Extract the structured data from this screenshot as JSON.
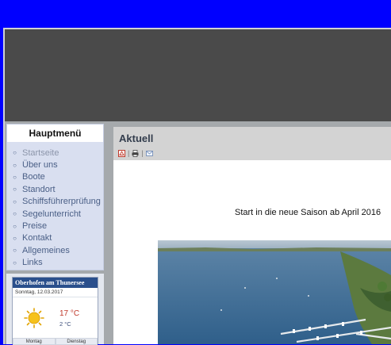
{
  "sidebar": {
    "title": "Hauptmenü",
    "items": [
      {
        "label": "Startseite",
        "active": true
      },
      {
        "label": "Über uns"
      },
      {
        "label": "Boote"
      },
      {
        "label": "Standort"
      },
      {
        "label": "Schiffsführerprüfung"
      },
      {
        "label": "Segelunterricht"
      },
      {
        "label": "Preise"
      },
      {
        "label": "Kontakt"
      },
      {
        "label": "Allgemeines"
      },
      {
        "label": "Links"
      }
    ]
  },
  "weather": {
    "location": "Oberhofen am Thunersee",
    "date": "Sonntag, 12.03.2017",
    "temp_high": "17 °C",
    "temp_low": "2 °C",
    "days": [
      "Montag",
      "Dienstag"
    ]
  },
  "content": {
    "title": "Aktuell",
    "announcement": "Start in die neue Saison ab April 2016",
    "toolbar_icons": [
      "pdf-icon",
      "print-icon",
      "email-icon"
    ]
  },
  "colors": {
    "page_background": "#0000ff",
    "banner": "#4a4a4a",
    "menu_link": "#4a5f86",
    "weather_header": "#2a4f8c"
  }
}
